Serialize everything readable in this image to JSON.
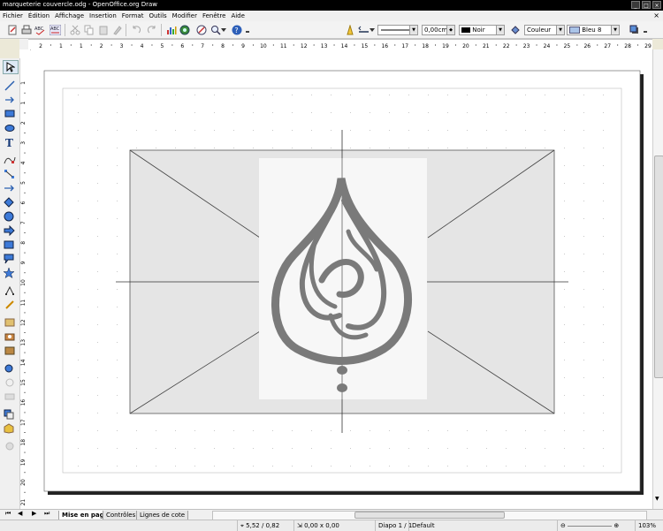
{
  "window": {
    "title": "marqueterie couvercle.odg - OpenOffice.org Draw"
  },
  "menu": {
    "items": [
      "Fichier",
      "Édition",
      "Affichage",
      "Insertion",
      "Format",
      "Outils",
      "Modifier",
      "Fenêtre",
      "Aide"
    ]
  },
  "toolbar": {
    "line_width": "0,00cm",
    "line_color": "Noir",
    "area_style": "Couleur",
    "area_color": "Bleu 8"
  },
  "hruler": {
    "ticks": [
      "2",
      "1",
      "1",
      "2",
      "3",
      "4",
      "5",
      "6",
      "7",
      "8",
      "9",
      "10",
      "11",
      "12",
      "13",
      "14",
      "15",
      "16",
      "17",
      "18",
      "19",
      "20",
      "21",
      "22",
      "23",
      "24",
      "25",
      "26",
      "27",
      "28",
      "29"
    ]
  },
  "vruler": {
    "ticks": [
      "1",
      "1",
      "2",
      "3",
      "4",
      "5",
      "6",
      "7",
      "8",
      "9",
      "10",
      "11",
      "12",
      "13",
      "14",
      "15",
      "16",
      "17",
      "18",
      "19",
      "20",
      "21"
    ]
  },
  "tabs": [
    "Mise en page",
    "Contrôles",
    "Lignes de cote"
  ],
  "status": {
    "position": "5,52 / 0,82",
    "size": "0,00 x 0,00",
    "slide": "Diapo 1 / 1",
    "layout": "Default",
    "zoom": "103%"
  },
  "colors": {
    "title_bg": "#000000",
    "frame_gray": "#e5e5e5",
    "calligraphy": "#7a7a7a"
  }
}
